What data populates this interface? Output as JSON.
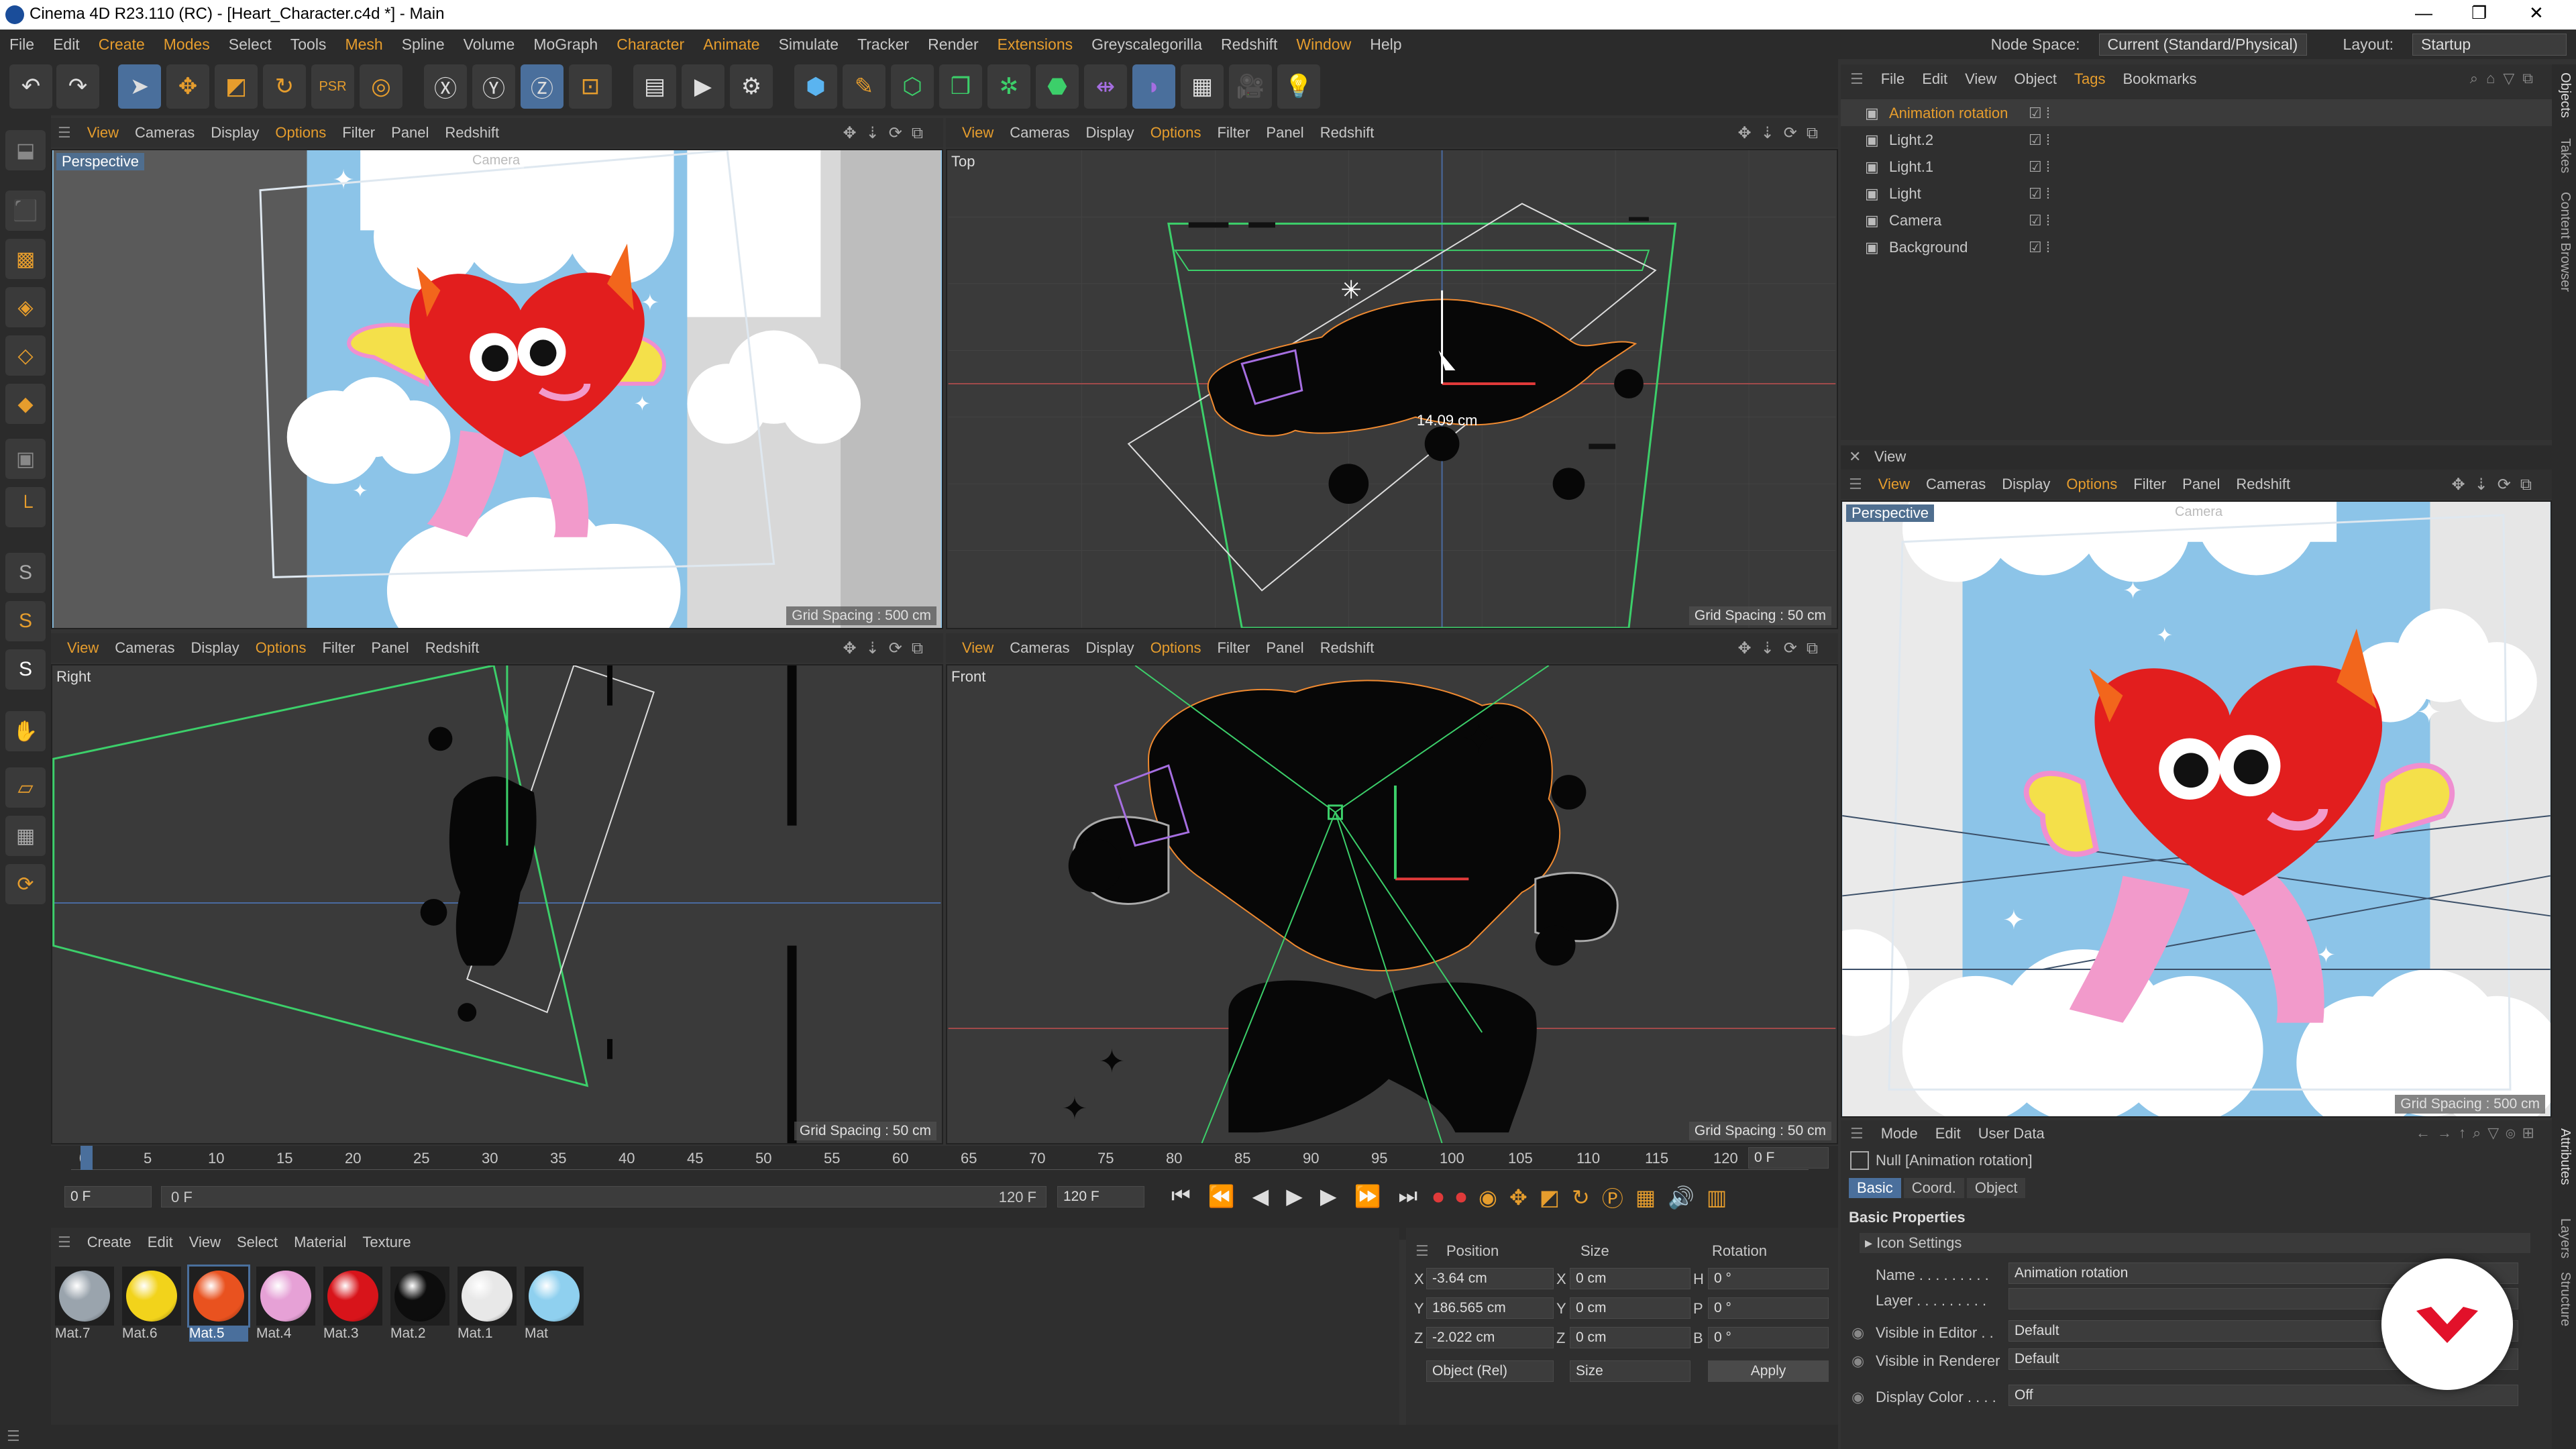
{
  "window": {
    "title": "Cinema 4D R23.110 (RC) - [Heart_Character.c4d *] - Main",
    "minimize": "—",
    "maximize": "❐",
    "close": "✕"
  },
  "menubar": {
    "items": [
      "File",
      "Edit",
      "Create",
      "Modes",
      "Select",
      "Tools",
      "Mesh",
      "Spline",
      "Volume",
      "MoGraph",
      "Character",
      "Animate",
      "Simulate",
      "Tracker",
      "Render",
      "Extensions",
      "Greyscalegorilla",
      "Redshift",
      "Window",
      "Help"
    ],
    "node_space_label": "Node Space:",
    "node_space_value": "Current (Standard/Physical)",
    "layout_label": "Layout:",
    "layout_value": "Startup"
  },
  "toolbar_icons": [
    "undo-icon",
    "redo-icon",
    "select-icon",
    "move-icon",
    "scale-icon",
    "rotate-icon",
    "psr-icon",
    "recent-tool-icon",
    "x-axis-icon",
    "y-axis-icon",
    "z-axis-icon",
    "coordinate-system-icon",
    "render-region-icon",
    "render-view-icon",
    "render-settings-icon",
    "cube-icon",
    "pen-icon",
    "subdivision-icon",
    "cloner-icon",
    "array-icon",
    "symmetry-icon",
    "deformer-icon",
    "floor-icon",
    "camera-icon",
    "light-icon"
  ],
  "viewport_menu": [
    "View",
    "Cameras",
    "Display",
    "Options",
    "Filter",
    "Panel",
    "Redshift"
  ],
  "viewports": {
    "perspective": {
      "label": "Perspective",
      "camera_tag": "Camera",
      "grid": "Grid Spacing : 500 cm"
    },
    "top": {
      "label": "Top",
      "grid": "Grid Spacing : 50 cm",
      "measure": "14.09 cm"
    },
    "right": {
      "label": "Right",
      "grid": "Grid Spacing : 50 cm"
    },
    "front": {
      "label": "Front",
      "grid": "Grid Spacing : 50 cm"
    },
    "side": {
      "panel_title": "View",
      "label": "Perspective",
      "camera_tag": "Camera",
      "grid": "Grid Spacing : 500 cm"
    }
  },
  "timeline": {
    "ticks": [
      "0",
      "5",
      "10",
      "15",
      "20",
      "25",
      "30",
      "35",
      "40",
      "45",
      "50",
      "55",
      "60",
      "65",
      "70",
      "75",
      "80",
      "85",
      "90",
      "95",
      "100",
      "105",
      "110",
      "115",
      "120"
    ],
    "current_frame_field": "0 F",
    "start": "0 F",
    "range_start": "0 F",
    "range_end": "120 F",
    "end": "120 F"
  },
  "material_manager": {
    "menu": [
      "Create",
      "Edit",
      "View",
      "Select",
      "Material",
      "Texture"
    ],
    "materials": [
      {
        "name": "Mat.7",
        "color": "#9aa4ad"
      },
      {
        "name": "Mat.6",
        "color": "#f2d31b"
      },
      {
        "name": "Mat.5",
        "color": "#e9521f",
        "selected": true
      },
      {
        "name": "Mat.4",
        "color": "#e6a1d6"
      },
      {
        "name": "Mat.3",
        "color": "#d8141a"
      },
      {
        "name": "Mat.2",
        "color": "#0d0d0d"
      },
      {
        "name": "Mat.1",
        "color": "#e8e8e8"
      },
      {
        "name": "Mat",
        "color": "#8fd0ef"
      }
    ]
  },
  "coordinates": {
    "headers": [
      "Position",
      "Size",
      "Rotation"
    ],
    "rows": [
      {
        "axis": "X",
        "pos": "-3.64 cm",
        "size_axis": "X",
        "size": "0 cm",
        "rot_axis": "H",
        "rot": "0 °"
      },
      {
        "axis": "Y",
        "pos": "186.565 cm",
        "size_axis": "Y",
        "size": "0 cm",
        "rot_axis": "P",
        "rot": "0 °"
      },
      {
        "axis": "Z",
        "pos": "-2.022 cm",
        "size_axis": "Z",
        "size": "0 cm",
        "rot_axis": "B",
        "rot": "0 °"
      }
    ],
    "mode_dropdown": "Object (Rel)",
    "size_dropdown": "Size",
    "apply": "Apply"
  },
  "object_manager": {
    "menu": [
      "File",
      "Edit",
      "View",
      "Object",
      "Tags",
      "Bookmarks"
    ],
    "objects": [
      {
        "name": "Animation rotation",
        "selected": true
      },
      {
        "name": "Light.2"
      },
      {
        "name": "Light.1"
      },
      {
        "name": "Light"
      },
      {
        "name": "Camera"
      },
      {
        "name": "Background"
      }
    ]
  },
  "attribute_manager": {
    "menu": [
      "Mode",
      "Edit",
      "User Data"
    ],
    "object_title": "Null [Animation rotation]",
    "tabs": [
      "Basic",
      "Coord.",
      "Object"
    ],
    "section": "Basic Properties",
    "icon_settings": "Icon Settings",
    "fields": [
      {
        "label": "Name . . . . . . . . .",
        "value": "Animation rotation"
      },
      {
        "label": "Layer . . . . . . . . .",
        "value": ""
      },
      {
        "label": "Visible in Editor . .",
        "value": "Default"
      },
      {
        "label": "Visible in Renderer",
        "value": "Default"
      },
      {
        "label": "Display Color . . . .",
        "value": "Off"
      }
    ]
  },
  "right_sidebar": [
    "Objects",
    "Takes",
    "Content Browser",
    "Attributes",
    "Layers",
    "Structure"
  ],
  "colors": {
    "accent": "#e69d2d",
    "selection": "#4a6f9c",
    "sky": "#8cc4e8",
    "heart": "#e21e1e"
  }
}
